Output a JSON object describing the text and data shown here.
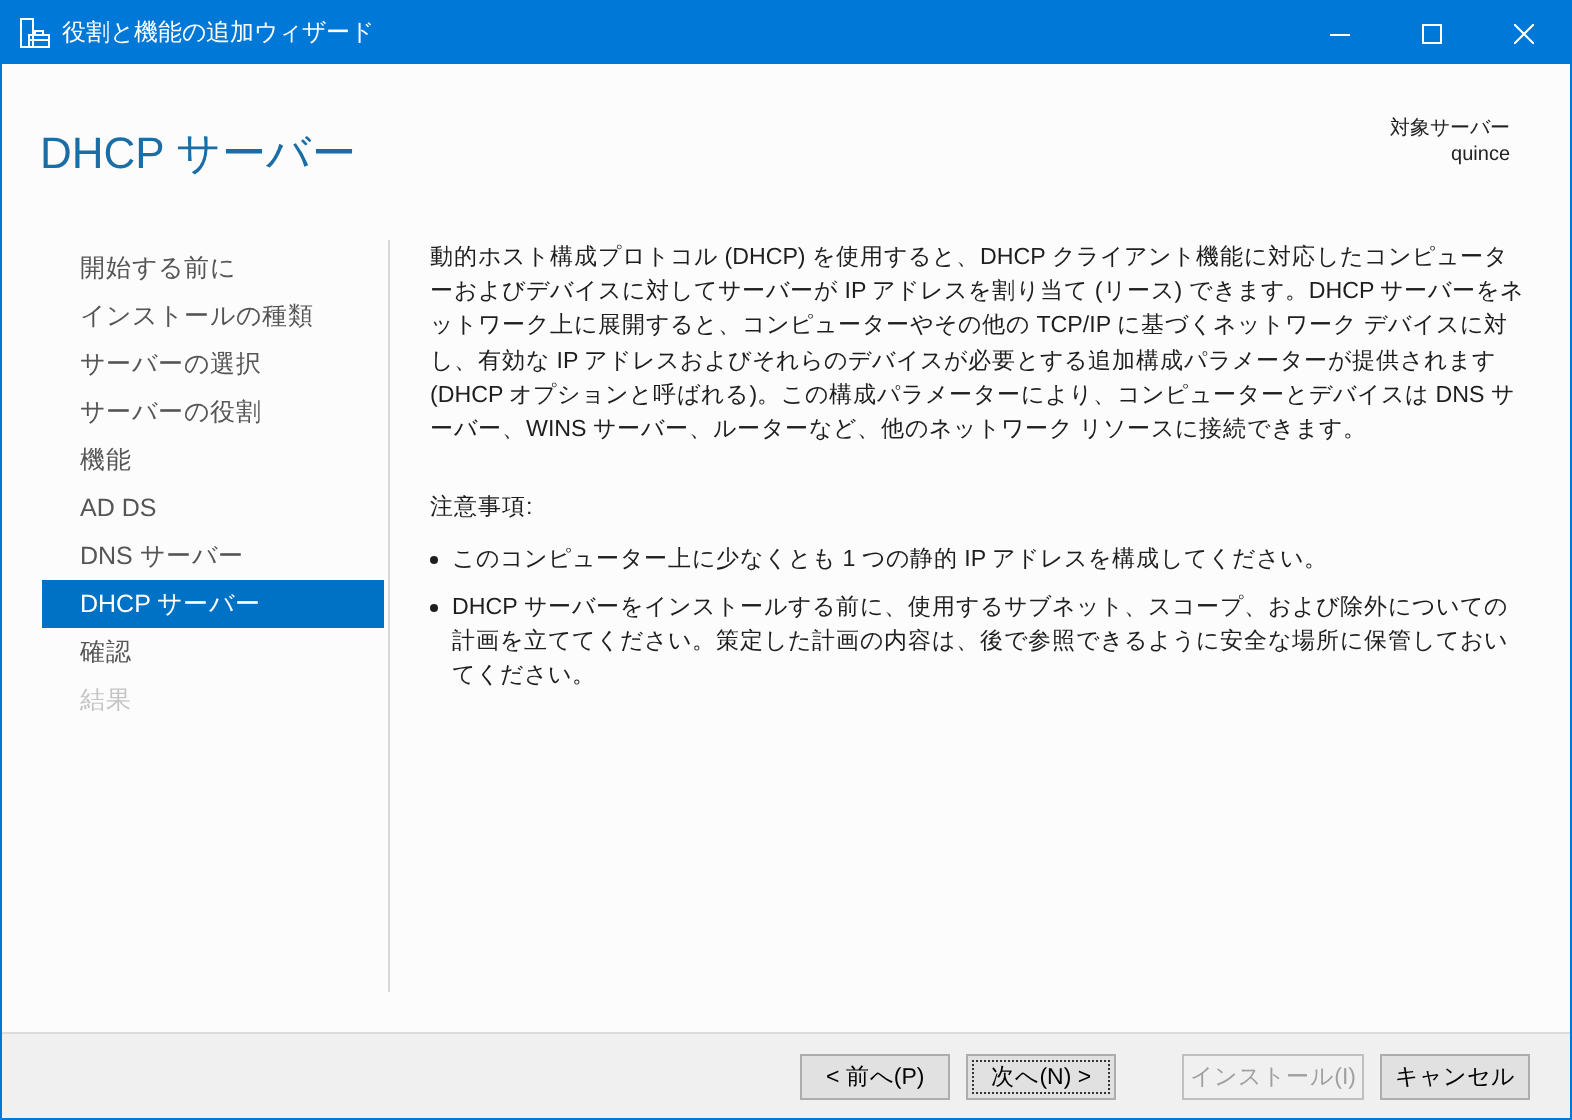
{
  "window": {
    "title": "役割と機能の追加ウィザード"
  },
  "page_title": "DHCP サーバー",
  "target_server": {
    "label": "対象サーバー",
    "name": "quince"
  },
  "nav": [
    {
      "label": "開始する前に",
      "selected": false,
      "disabled": false
    },
    {
      "label": "インストールの種類",
      "selected": false,
      "disabled": false
    },
    {
      "label": "サーバーの選択",
      "selected": false,
      "disabled": false
    },
    {
      "label": "サーバーの役割",
      "selected": false,
      "disabled": false
    },
    {
      "label": "機能",
      "selected": false,
      "disabled": false
    },
    {
      "label": "AD DS",
      "selected": false,
      "disabled": false
    },
    {
      "label": "DNS サーバー",
      "selected": false,
      "disabled": false
    },
    {
      "label": "DHCP サーバー",
      "selected": true,
      "disabled": false
    },
    {
      "label": "確認",
      "selected": false,
      "disabled": false
    },
    {
      "label": "結果",
      "selected": false,
      "disabled": true
    }
  ],
  "description": "動的ホスト構成プロトコル (DHCP) を使用すると、DHCP クライアント機能に対応したコンピューターおよびデバイスに対してサーバーが IP アドレスを割り当て (リース) できます。DHCP サーバーをネットワーク上に展開すると、コンピューターやその他の TCP/IP に基づくネットワーク デバイスに対し、有効な IP アドレスおよびそれらのデバイスが必要とする追加構成パラメーターが提供されます (DHCP オプションと呼ばれる)。この構成パラメーターにより、コンピューターとデバイスは DNS サーバー、WINS サーバー、ルーターなど、他のネットワーク リソースに接続できます。",
  "notes_heading": "注意事項:",
  "notes": [
    "このコンピューター上に少なくとも 1 つの静的 IP アドレスを構成してください。",
    "DHCP サーバーをインストールする前に、使用するサブネット、スコープ、および除外についての計画を立ててください。策定した計画の内容は、後で参照できるように安全な場所に保管しておいてください。"
  ],
  "buttons": [
    {
      "label": "< 前へ(P)",
      "disabled": false,
      "focused": false
    },
    {
      "label": "次へ(N) >",
      "disabled": false,
      "focused": true
    },
    {
      "label": "インストール(I)",
      "disabled": true,
      "focused": false
    },
    {
      "label": "キャンセル",
      "disabled": false,
      "focused": false
    }
  ]
}
